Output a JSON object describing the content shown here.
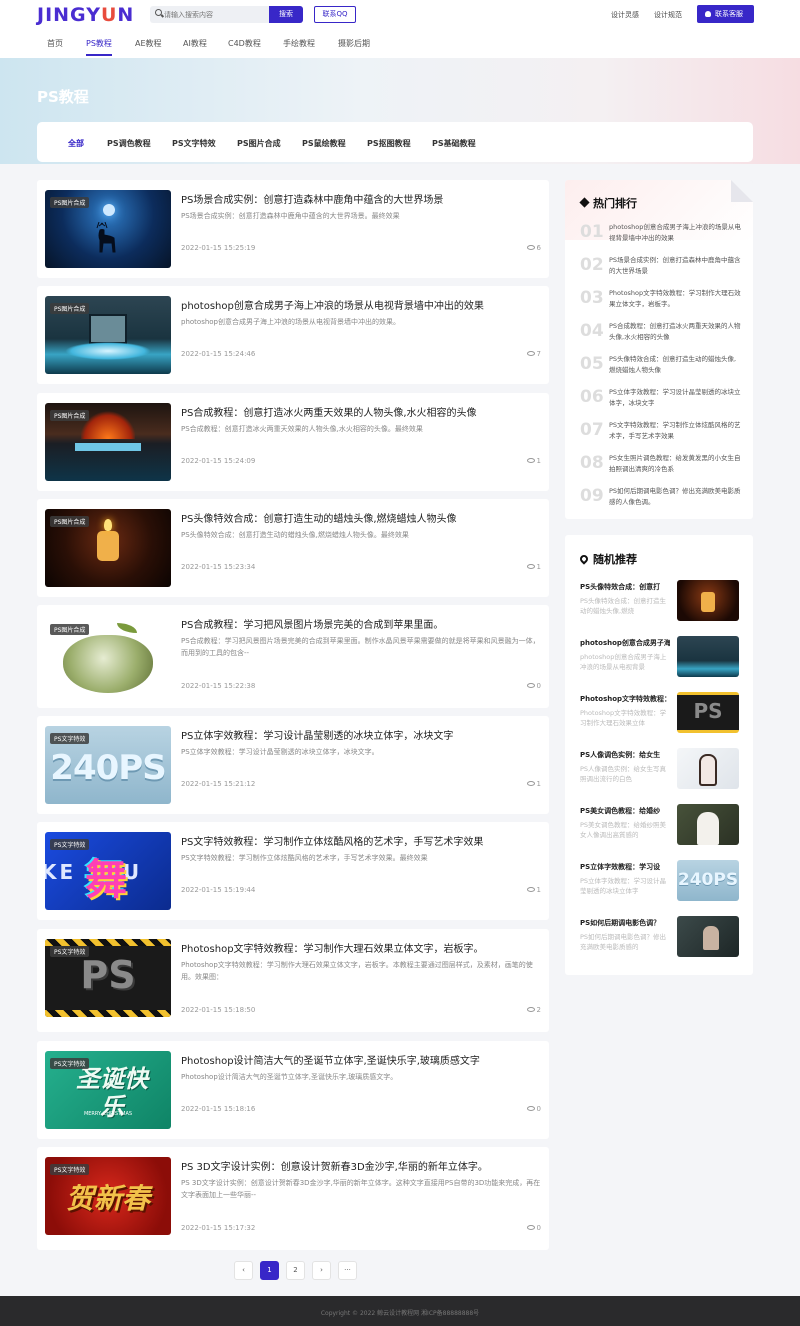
{
  "header": {
    "logo_main": "JINGY",
    "logo_accent": "U",
    "logo_tail": "N",
    "search_placeholder": "请输入搜索内容",
    "search_button": "搜索",
    "qq_button": "联系QQ",
    "link_inspiration": "设计灵感",
    "link_standards": "设计规范",
    "service_button": "联系客服"
  },
  "nav": {
    "items": [
      "首页",
      "PS教程",
      "AE教程",
      "AI教程",
      "C4D教程",
      "手绘教程",
      "摄影后期"
    ],
    "active": "PS教程"
  },
  "banner": {
    "title": "PS教程"
  },
  "tabs": [
    "全部",
    "PS调色教程",
    "PS文字特效",
    "PS图片合成",
    "PS鼠绘教程",
    "PS抠图教程",
    "PS基础教程"
  ],
  "articles": [
    {
      "tag": "PS图片合成",
      "title": "PS场景合成实例：创意打造森林中鹿角中蕴含的大世界场景",
      "desc": "PS场景合成实例：创意打造森林中鹿角中蕴含的大世界场景。最终效果",
      "date": "2022-01-15 15:25:19",
      "views": "6"
    },
    {
      "tag": "PS图片合成",
      "title": "photoshop创意合成男子海上冲浪的场景从电视背景墙中冲出的效果",
      "desc": "photoshop创意合成男子海上冲浪的场景从电视背景墙中冲出的效果。",
      "date": "2022-01-15 15:24:46",
      "views": "7"
    },
    {
      "tag": "PS图片合成",
      "title": "PS合成教程：创意打造冰火两重天效果的人物头像,水火相容的头像",
      "desc": "PS合成教程：创意打造冰火两重天效果的人物头像,水火相容的头像。最终效果",
      "date": "2022-01-15 15:24:09",
      "views": "1"
    },
    {
      "tag": "PS图片合成",
      "title": "PS头像特效合成：创意打造生动的蜡烛头像,燃烧蜡烛人物头像",
      "desc": "PS头像特效合成：创意打造生动的蜡烛头像,燃烧蜡烛人物头像。最终效果",
      "date": "2022-01-15 15:23:34",
      "views": "1"
    },
    {
      "tag": "PS图片合成",
      "title": "PS合成教程：学习把风景图片场景完美的合成到苹果里面。",
      "desc": "PS合成教程：学习把风景图片场景完美的合成到苹果里面。制作水晶风景苹果需要做的就是将苹果和风景融为一体，而用到的工具的包含--",
      "date": "2022-01-15 15:22:38",
      "views": "0"
    },
    {
      "tag": "PS文字特效",
      "title": "PS立体字效教程：学习设计晶莹剔透的冰块立体字，冰块文字",
      "desc": "PS立体字效教程：学习设计晶莹剔透的冰块立体字，冰块文字。",
      "date": "2022-01-15 15:21:12",
      "views": "1"
    },
    {
      "tag": "PS文字特效",
      "title": "PS文字特效教程：学习制作立体炫酷风格的艺术字，手写艺术字效果",
      "desc": "PS文字特效教程：学习制作立体炫酷风格的艺术字，手写艺术字效果。最终效果",
      "date": "2022-01-15 15:19:44",
      "views": "1"
    },
    {
      "tag": "PS文字特效",
      "title": "Photoshop文字特效教程：学习制作大理石效果立体文字，岩板字。",
      "desc": "Photoshop文字特效教程：学习制作大理石效果立体文字，岩板字。本教程主要通过图层样式，及素材，画笔的使用。效果图：",
      "date": "2022-01-15 15:18:50",
      "views": "2"
    },
    {
      "tag": "PS文字特效",
      "title": "Photoshop设计简洁大气的圣诞节立体字,圣诞快乐字,玻璃质感文字",
      "desc": "Photoshop设计简洁大气的圣诞节立体字,圣诞快乐字,玻璃质感文字。",
      "date": "2022-01-15 15:18:16",
      "views": "0"
    },
    {
      "tag": "PS文字特效",
      "title": "PS 3D文字设计实例：创意设计贺新春3D金沙字,华丽的新年立体字。",
      "desc": "PS 3D文字设计实例：创意设计贺新春3D金沙字,华丽的新年立体字。这种文字直接用PS自带的3D功能来完成，再在文字表面加上一些华丽--",
      "date": "2022-01-15 15:17:32",
      "views": "0"
    }
  ],
  "thumb_texts": {
    "ice": "240PS",
    "stone": "PS",
    "xmas": "圣诞快乐",
    "xmas_small": "MERRY CHRISTMAS",
    "newyear": "贺新春",
    "dance": "舞",
    "dance_bg": "KE YOU"
  },
  "hot": {
    "title": "热门排行",
    "items": [
      {
        "num": "01",
        "text": "photoshop创意合成男子海上冲浪的场景从电视背景墙中冲出的效果"
      },
      {
        "num": "02",
        "text": "PS场景合成实例：创意打造森林中鹿角中蕴含的大世界场景"
      },
      {
        "num": "03",
        "text": "Photoshop文字特效教程：学习制作大理石效果立体文字，岩板字。"
      },
      {
        "num": "04",
        "text": "PS合成教程：创意打造冰火两重天效果的人物头像,水火相容的头像"
      },
      {
        "num": "05",
        "text": "PS头像特效合成：创意打造生动的蜡烛头像,燃烧蜡烛人物头像"
      },
      {
        "num": "06",
        "text": "PS立体字效教程：学习设计晶莹剔透的冰块立体字，冰块文字"
      },
      {
        "num": "07",
        "text": "PS文字特效教程：学习制作立体炫酷风格的艺术字，手写艺术字效果"
      },
      {
        "num": "08",
        "text": "PS女生照片调色教程：给发黄发黑的小女生自拍照调出清爽的冷色系"
      },
      {
        "num": "09",
        "text": "PS如何后期调电影色调？修出充满欧美电影质感的人像色调。"
      }
    ]
  },
  "recommend": {
    "title": "随机推荐",
    "items": [
      {
        "title": "PS头像特效合成：创意打",
        "desc": "PS头像特效合成：创意打造生动的蜡烛头像,燃烧"
      },
      {
        "title": "photoshop创意合成男子海",
        "desc": "photoshop创意合成男子海上冲浪的场景从电视背景"
      },
      {
        "title": "Photoshop文字特效教程：",
        "desc": "Photoshop文字特效教程：学习制作大理石效果立体"
      },
      {
        "title": "PS人像调色实例：给女生",
        "desc": "PS人像调色实例：给女生写真照调出流行的白色"
      },
      {
        "title": "PS美女调色教程：给婚纱",
        "desc": "PS美女调色教程：给婚纱照美女人像调出高質感的"
      },
      {
        "title": "PS立体字效教程：学习设",
        "desc": "PS立体字效教程：学习设计晶莹剔透的冰块立体字"
      },
      {
        "title": "PS如何后期调电影色调？",
        "desc": "PS如何后期调电影色调？修出充满欧美电影质感的"
      }
    ]
  },
  "pagination": {
    "prev": "‹",
    "pages": [
      "1",
      "2"
    ],
    "next": "›",
    "more": "···",
    "current": "1"
  },
  "footer": {
    "copyright": "Copyright © 2022 鲸云设计教程网 湘ICP备88888888号"
  },
  "colors": {
    "accent": "#3827c8",
    "footer_bg": "#2a2a2c",
    "page_bg": "#f4f5f8"
  }
}
